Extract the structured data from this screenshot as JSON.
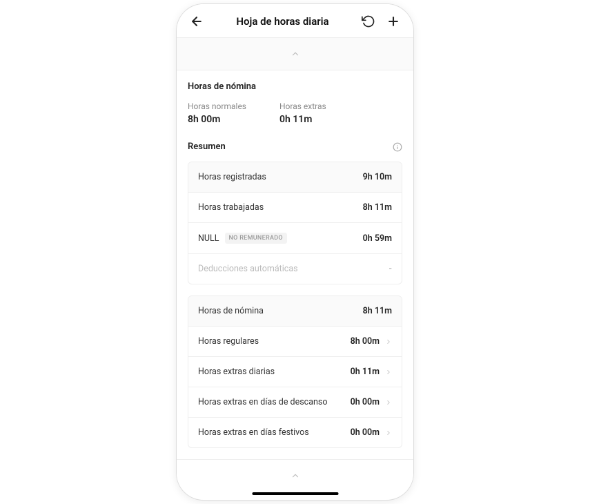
{
  "header": {
    "title": "Hoja de horas diaria"
  },
  "payroll": {
    "title": "Horas de nómina",
    "regular_label": "Horas normales",
    "regular_value": "8h 00m",
    "overtime_label": "Horas extras",
    "overtime_value": "0h 11m"
  },
  "summary": {
    "title": "Resumen",
    "rows": [
      {
        "label": "Horas registradas",
        "value": "9h 10m"
      },
      {
        "label": "Horas trabajadas",
        "value": "8h 11m"
      },
      {
        "label": "NULL",
        "value": "0h 59m",
        "badge": "NO REMUNERADO"
      },
      {
        "label": "Deducciones automáticas",
        "value": "-"
      }
    ]
  },
  "breakdown": {
    "rows": [
      {
        "label": "Horas de nómina",
        "value": "8h 11m"
      },
      {
        "label": "Horas regulares",
        "value": "8h 00m"
      },
      {
        "label": "Horas extras diarias",
        "value": "0h 11m"
      },
      {
        "label": "Horas extras en días de descanso",
        "value": "0h 00m"
      },
      {
        "label": "Horas extras en días festivos",
        "value": "0h 00m"
      }
    ]
  }
}
